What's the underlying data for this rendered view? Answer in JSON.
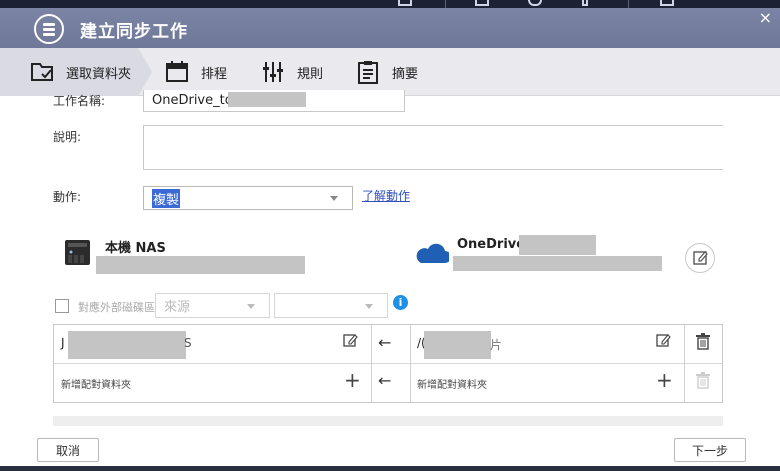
{
  "window": {
    "title": "建立同步工作",
    "close_glyph": "×"
  },
  "steps": [
    {
      "label": "選取資料夾",
      "icon": "folder-select-icon"
    },
    {
      "label": "排程",
      "icon": "calendar-icon"
    },
    {
      "label": "規則",
      "icon": "sliders-icon"
    },
    {
      "label": "摘要",
      "icon": "clipboard-icon"
    }
  ],
  "form": {
    "job_name_label": "工作名稱:",
    "job_name_value": "OneDrive_to_",
    "description_label": "說明:",
    "action_label": "動作:",
    "action_value": "複製",
    "action_help_link": "了解動作"
  },
  "local": {
    "title": "本機 NAS"
  },
  "remote": {
    "title": "OneDrive"
  },
  "external": {
    "checkbox_label": "對應外部磁碟區",
    "source_placeholder": "來源"
  },
  "pairs": {
    "row1_local": "J",
    "row1_local_tail": "S",
    "row1_remote": "/(",
    "row1_remote_tail": "片",
    "add_local": "新增配對資料夾",
    "add_remote": "新增配對資料夾",
    "arrow": "←",
    "plus": "+"
  },
  "footer": {
    "cancel": "取消",
    "next": "下一步"
  }
}
